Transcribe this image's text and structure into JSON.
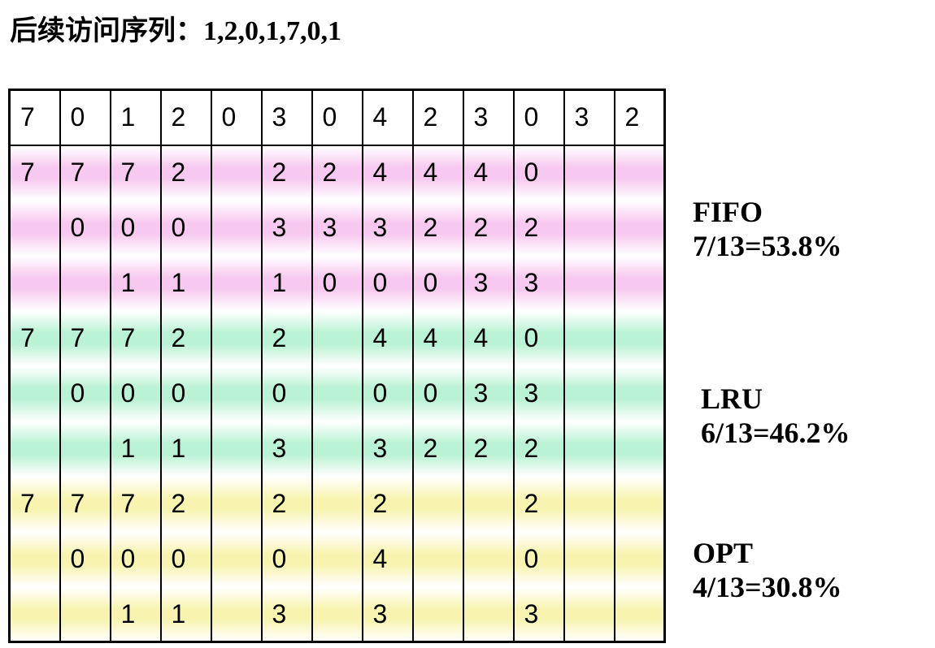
{
  "heading": "后续访问序列：1,2,0,1,7,0,1",
  "reference_row": [
    "7",
    "0",
    "1",
    "2",
    "0",
    "3",
    "0",
    "4",
    "2",
    "3",
    "0",
    "3",
    "2"
  ],
  "fifo": {
    "name": "FIFO",
    "rate": "7/13=53.8%",
    "rows": [
      [
        "7",
        "7",
        "7",
        "2",
        "",
        "2",
        "2",
        "4",
        "4",
        "4",
        "0",
        "",
        ""
      ],
      [
        "",
        "0",
        "0",
        "0",
        "",
        "3",
        "3",
        "3",
        "2",
        "2",
        "2",
        "",
        ""
      ],
      [
        "",
        "",
        "1",
        "1",
        "",
        "1",
        "0",
        "0",
        "0",
        "3",
        "3",
        "",
        ""
      ]
    ]
  },
  "lru": {
    "name": "LRU",
    "rate": "6/13=46.2%",
    "rows": [
      [
        "7",
        "7",
        "7",
        "2",
        "",
        "2",
        "",
        "4",
        "4",
        "4",
        "0",
        "",
        ""
      ],
      [
        "",
        "0",
        "0",
        "0",
        "",
        "0",
        "",
        "0",
        "0",
        "3",
        "3",
        "",
        ""
      ],
      [
        "",
        "",
        "1",
        "1",
        "",
        "3",
        "",
        "3",
        "2",
        "2",
        "2",
        "",
        ""
      ]
    ]
  },
  "opt": {
    "name": "OPT",
    "rate": "4/13=30.8%",
    "rows": [
      [
        "7",
        "7",
        "7",
        "2",
        "",
        "2",
        "",
        "2",
        "",
        "",
        "2",
        "",
        ""
      ],
      [
        "",
        "0",
        "0",
        "0",
        "",
        "0",
        "",
        "4",
        "",
        "",
        "0",
        "",
        ""
      ],
      [
        "",
        "",
        "1",
        "1",
        "",
        "3",
        "",
        "3",
        "",
        "",
        "3",
        "",
        ""
      ]
    ]
  },
  "colors": {
    "fifo_band": "#f7c8f0",
    "lru_band": "#b9f2d4",
    "opt_band": "#f8f4b0"
  }
}
